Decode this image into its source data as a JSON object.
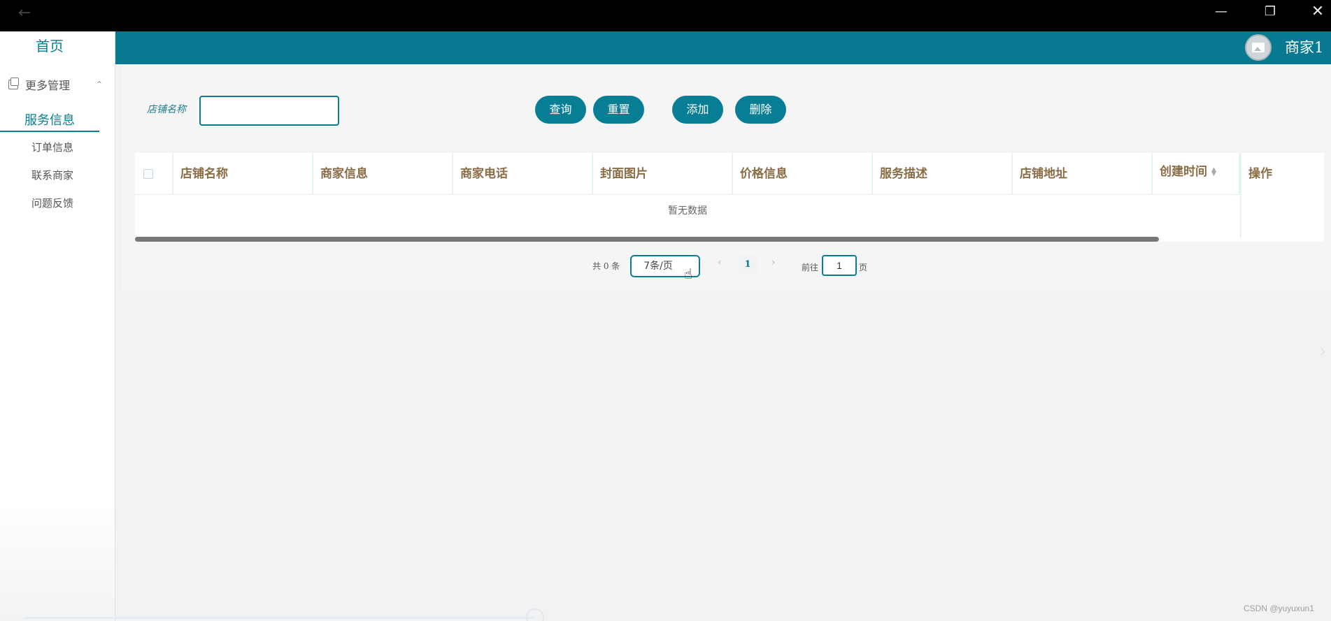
{
  "window": {
    "back_icon": "arrow-left-icon",
    "minimize_icon": "minimize-icon",
    "restore_icon": "restore-icon",
    "close_icon": "close-icon"
  },
  "sidebar": {
    "home": "首页",
    "group_label": "更多管理",
    "group_icon": "copy-icon",
    "active_item": "服务信息",
    "items": [
      {
        "label": "订单信息"
      },
      {
        "label": "联系商家"
      },
      {
        "label": "问题反馈"
      }
    ]
  },
  "header": {
    "username": "商家1",
    "avatar_icon": "image-icon",
    "brand_color": "#077a91"
  },
  "search": {
    "label": "店铺名称",
    "value": ""
  },
  "buttons": {
    "query": "查询",
    "reset": "重置",
    "add": "添加",
    "delete": "删除"
  },
  "table": {
    "columns": [
      "店铺名称",
      "商家信息",
      "商家电话",
      "封面图片",
      "价格信息",
      "服务描述",
      "店铺地址",
      "创建时间",
      "操作"
    ],
    "empty_text": "暂无数据"
  },
  "pagination": {
    "total_text": "共 0 条",
    "page_size": "7条/页",
    "current_page": "1",
    "goto_label": "前往",
    "goto_value": "1",
    "page_unit": "页"
  },
  "watermark": "CSDN @yuyuxun1"
}
